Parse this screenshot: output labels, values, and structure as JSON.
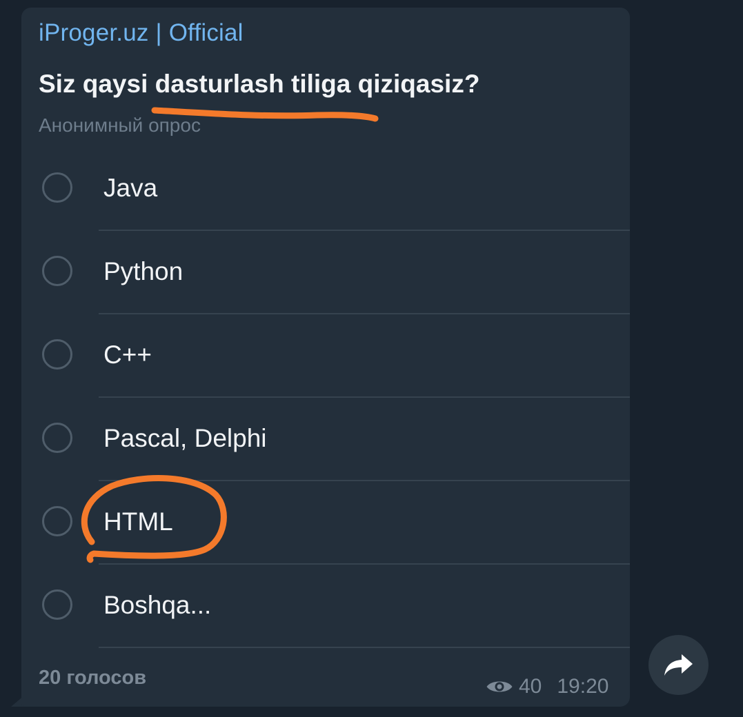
{
  "post": {
    "channel_name": "iProger.uz | Official",
    "question": "Siz qaysi dasturlash tiliga qiziqasiz?",
    "poll_type": "Анонимный опрос",
    "options": [
      {
        "label": "Java"
      },
      {
        "label": "Python"
      },
      {
        "label": "C++"
      },
      {
        "label": "Pascal, Delphi"
      },
      {
        "label": "HTML"
      },
      {
        "label": "Boshqa..."
      }
    ],
    "votes_label": "20 голосов",
    "views": "40",
    "time": "19:20"
  },
  "colors": {
    "background": "#18222d",
    "bubble": "#232f3b",
    "channel_name": "#71b5ef",
    "annotation": "#f47a2b"
  },
  "icons": {
    "views": "eye-icon",
    "share": "share-arrow-icon"
  }
}
